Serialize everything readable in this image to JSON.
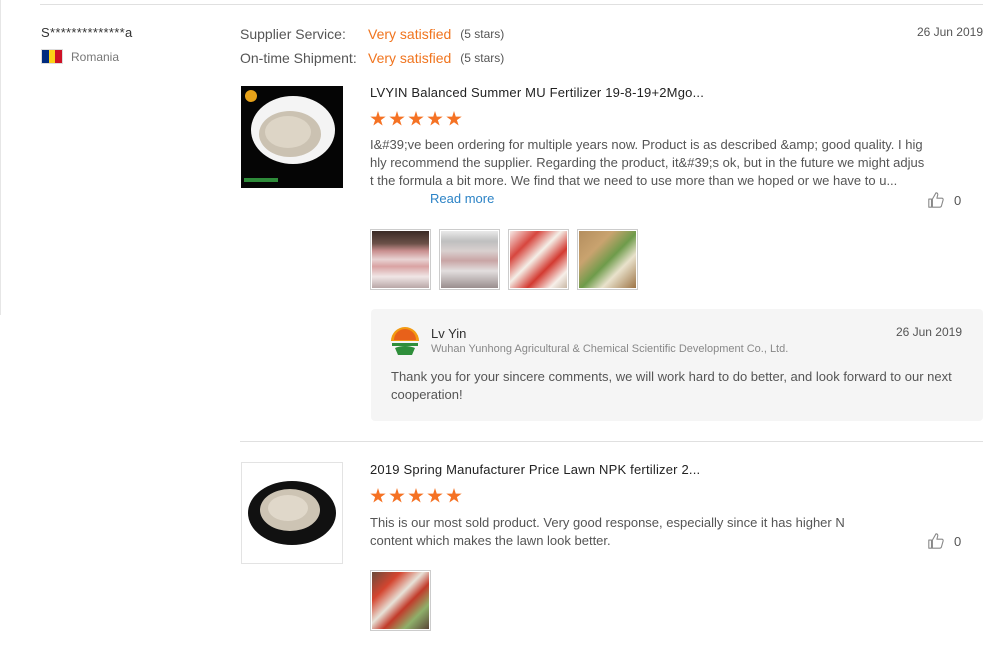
{
  "reviewer": {
    "name": "S**************a",
    "country": "Romania",
    "flag_colors": [
      "#002B7F",
      "#FCD116",
      "#CE1126"
    ]
  },
  "ratings": [
    {
      "label": "Supplier Service:",
      "value": "Very satisfied",
      "count": "(5 stars)"
    },
    {
      "label": "On-time Shipment:",
      "value": "Very satisfied",
      "count": "(5 stars)"
    }
  ],
  "review_date": "26 Jun 2019",
  "accent_color": "#f57224",
  "reviews": [
    {
      "product_title": "LVYIN Balanced Summer MU Fertilizer 19-8-19+2Mgo...",
      "stars": 5,
      "text": "I&#39;ve been ordering for multiple years now. Product is as described &amp; good quality. I highly recommend the supplier. Regarding the product, it&#39;s ok, but in the future we might adjust the formula a bit more. We find that we need to use more than we hoped or we have to u...",
      "read_more": "Read more",
      "likes": "0",
      "photo_count": 4
    },
    {
      "product_title": "2019 Spring Manufacturer Price Lawn NPK fertilizer 2...",
      "stars": 5,
      "text": "This is our most sold product. Very good response, especially since it has higher N content which makes the lawn look better.",
      "likes": "0",
      "photo_count": 1
    }
  ],
  "reply": {
    "name": "Lv Yin",
    "company": "Wuhan Yunhong Agricultural & Chemical Scientific Development Co., Ltd.",
    "date": "26 Jun 2019",
    "text": "Thank you for your sincere comments, we will work hard to do better, and look forward to our next cooperation!"
  },
  "icons": {
    "like": "thumbs-up-icon",
    "company_logo": "sunrise-logo-icon"
  }
}
